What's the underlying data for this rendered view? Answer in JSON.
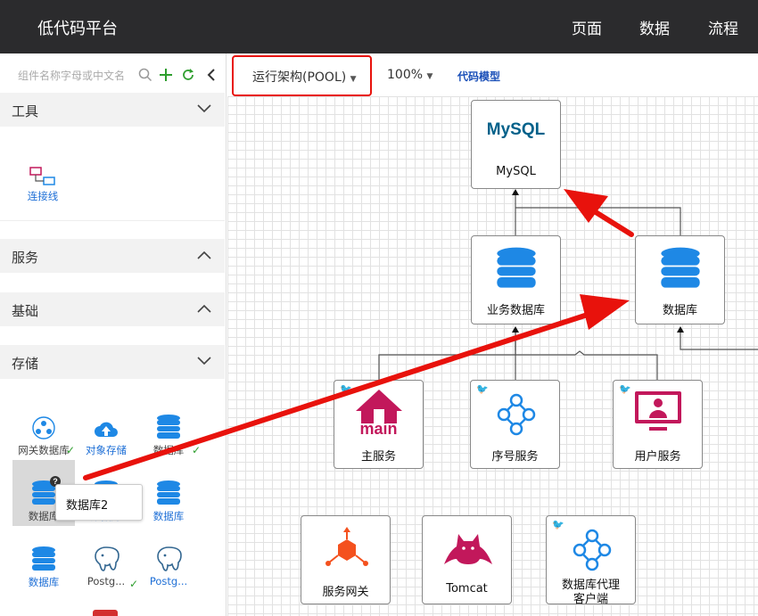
{
  "app": {
    "title": "低代码平台",
    "nav": [
      "页面",
      "数据",
      "流程"
    ]
  },
  "sidebar": {
    "search_placeholder": "组件名称字母或中文名",
    "sections": {
      "tools": "工具",
      "services": "服务",
      "basics": "基础",
      "storage": "存储"
    },
    "tools_items": [
      "连接线"
    ],
    "storage_items": [
      "网关数据库",
      "对象存储",
      "数据库",
      "数据库",
      "数据库",
      "数据库",
      "数据库",
      "Postg...",
      "Postg..."
    ],
    "tooltip": "数据库2"
  },
  "toolbar": {
    "arch_select": "运行架构(POOL)",
    "zoom": "100%",
    "code_model": "代码模型"
  },
  "canvas": {
    "nodes": {
      "mysql": "MySQL",
      "mysql_logo": "MySQL",
      "biz_db": "业务数据库",
      "db": "数据库",
      "main_service": "主服务",
      "main_text": "main",
      "seq_service": "序号服务",
      "user_service": "用户服务",
      "gateway": "服务网关",
      "tomcat": "Tomcat",
      "db_proxy_1": "数据库代理",
      "db_proxy_2": "客户端"
    }
  },
  "colors": {
    "topbar": "#2b2b2d",
    "accent_blue": "#1e88e5",
    "magenta": "#c2185b",
    "arrow_red": "#e8120c",
    "link_blue": "#1a4fb8",
    "green": "#2e9e2e"
  }
}
